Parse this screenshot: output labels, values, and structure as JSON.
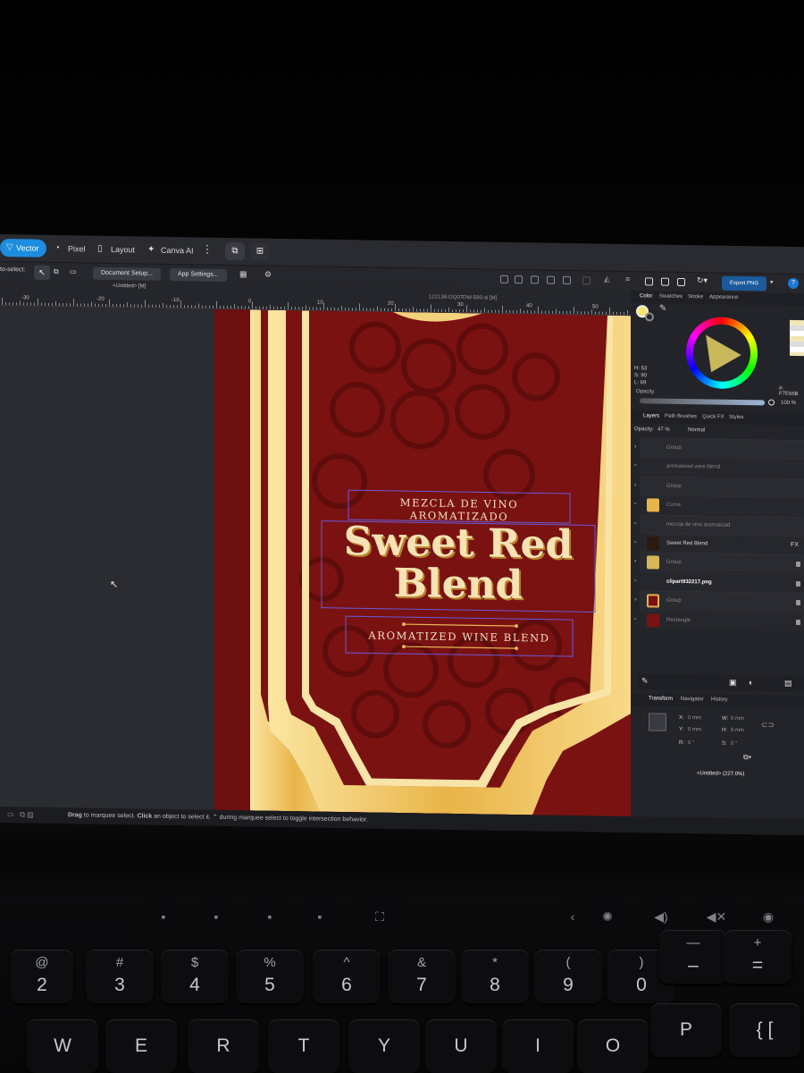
{
  "topbar": {
    "personas": [
      "Vector",
      "Pixel",
      "Layout",
      "Canva AI"
    ]
  },
  "toolbar": {
    "to_select_label": "to-select:",
    "document_setup": "Document Setup...",
    "app_settings": "App Settings...",
    "export_label": "Export PNG",
    "help": "?"
  },
  "document": {
    "untitled_tab": "<Untitled> [M]",
    "file_tab": "122138-OQ07DW-580.ai [M]",
    "ruler_numbers": [
      "-30",
      "-20",
      "-10",
      "0",
      "10",
      "20",
      "30",
      "40",
      "50"
    ]
  },
  "label_art": {
    "subtitle_top": "MEZCLA DE VINO AROMATIZADO",
    "title_line1": "Sweet Red",
    "title_line2": "Blend",
    "subtitle_bottom": "AROMATIZED WINE BLEND",
    "colors": {
      "wine": "#7d1313",
      "gold": "#f3c96a",
      "cream": "#f7e9c4"
    }
  },
  "color_panel": {
    "tabs": [
      "Color",
      "Swatches",
      "Stroke",
      "Appearance"
    ],
    "hsl": {
      "h": "H: 53",
      "s": "S: 90",
      "l": "L: 69"
    },
    "hex": "#: F7E66B",
    "opacity_label": "Opacity",
    "opacity_value": "100 %"
  },
  "layers_panel": {
    "tabs": [
      "Layers",
      "Path Brushes",
      "Quick FX",
      "Styles"
    ],
    "opacity_label": "Opacity:",
    "opacity_value": "47 %",
    "blend_mode": "Normal",
    "items": [
      "Group",
      "aromatized wine blend",
      "Group",
      "Curve",
      "mezcla de vino aromatizad",
      "Sweet Red Blend",
      "Group",
      "clipart932217.png",
      "Group",
      "Rectangle"
    ],
    "fx_label": "FX"
  },
  "transform_panel": {
    "tabs": [
      "Transform",
      "Navigator",
      "History"
    ],
    "x": "X:",
    "x_val": "0 mm",
    "y": "Y:",
    "y_val": "0 mm",
    "w": "W:",
    "w_val": "0 mm",
    "h": "H:",
    "h_val": "0 mm",
    "r": "R:",
    "r_val": "0 °",
    "s": "S:",
    "s_val": "0 °",
    "zoom_status": "<Untitled> (227.0%)"
  },
  "statusbar": {
    "drag": "Drag",
    "text1": " to marquee select. ",
    "click": "Click",
    "text2": " an object to select it. ",
    "text3": "⌃ during marquee select to toggle intersection behavior."
  },
  "keyboard": {
    "number_row": [
      {
        "top": "@",
        "bottom": "2"
      },
      {
        "top": "#",
        "bottom": "3"
      },
      {
        "top": "$",
        "bottom": "4"
      },
      {
        "top": "%",
        "bottom": "5"
      },
      {
        "top": "^",
        "bottom": "6"
      },
      {
        "top": "&",
        "bottom": "7"
      },
      {
        "top": "*",
        "bottom": "8"
      },
      {
        "top": "(",
        "bottom": "9"
      },
      {
        "top": ")",
        "bottom": "0"
      },
      {
        "top": "—",
        "bottom": "–"
      },
      {
        "top": "+",
        "bottom": "="
      }
    ],
    "letter_row": [
      "W",
      "E",
      "R",
      "T",
      "Y",
      "U",
      "I",
      "O",
      "P",
      "{ ["
    ]
  }
}
